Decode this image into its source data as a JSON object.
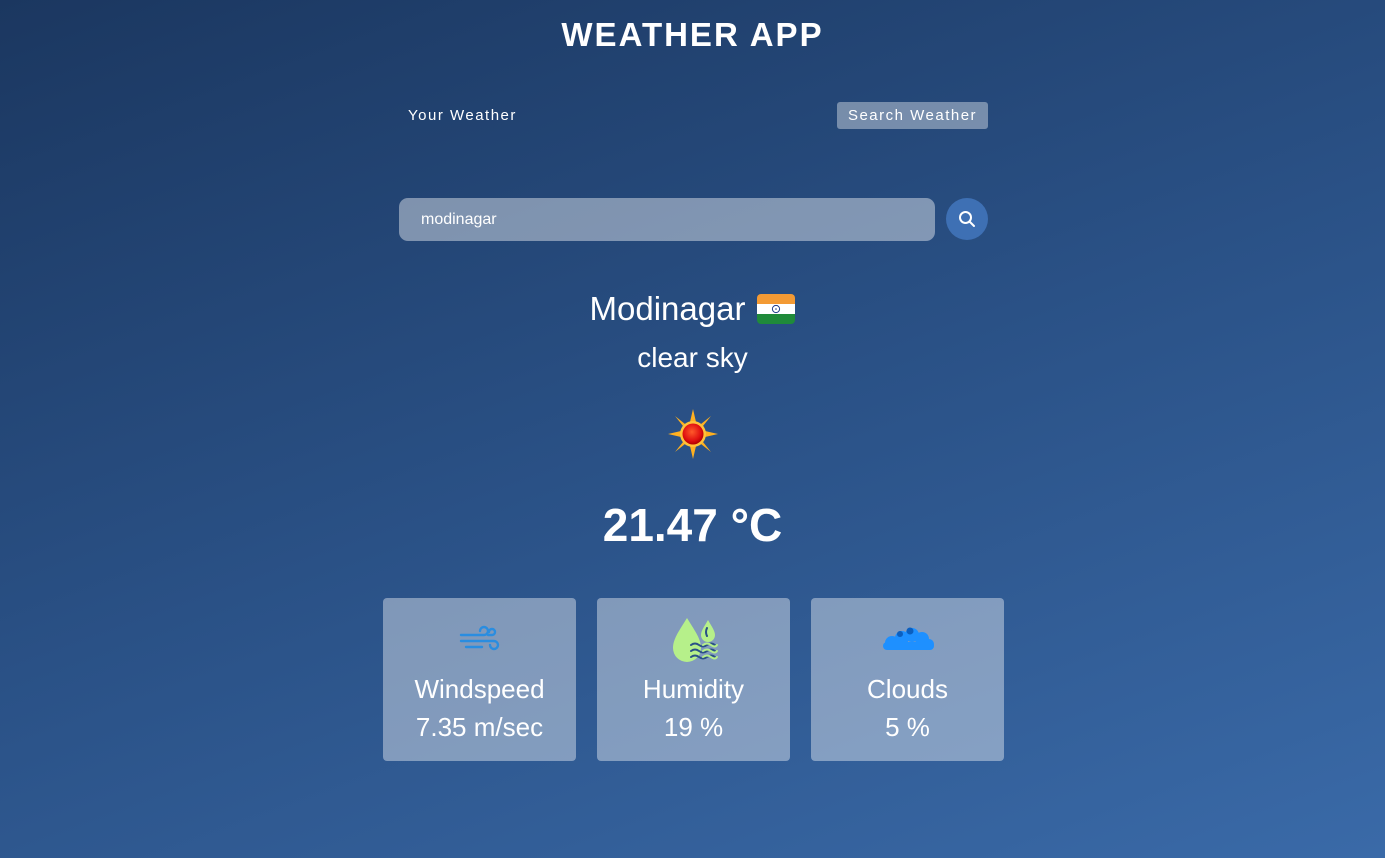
{
  "app": {
    "title": "WEATHER APP"
  },
  "tabs": {
    "your_weather": "Your Weather",
    "search_weather": "Search Weather",
    "active": "search_weather"
  },
  "search": {
    "value": "modinagar",
    "button_icon": "search-icon"
  },
  "location": {
    "city": "Modinagar",
    "flag_icon": "india-flag-icon",
    "condition": "clear sky",
    "condition_icon": "sun-icon",
    "temperature": "21.47 °C"
  },
  "stats": [
    {
      "label": "Windspeed",
      "value": "7.35 m/sec",
      "icon": "wind-icon"
    },
    {
      "label": "Humidity",
      "value": "19 %",
      "icon": "humidity-icon"
    },
    {
      "label": "Clouds",
      "value": "5 %",
      "icon": "clouds-icon"
    }
  ],
  "colors": {
    "background_top": "#1b3760",
    "background_bottom": "#3a6aa8",
    "search_button": "#3e70b4",
    "wind_icon": "#2a8de0",
    "humidity_icon": "#b6f08a",
    "clouds_icon": "#1e90ff"
  }
}
